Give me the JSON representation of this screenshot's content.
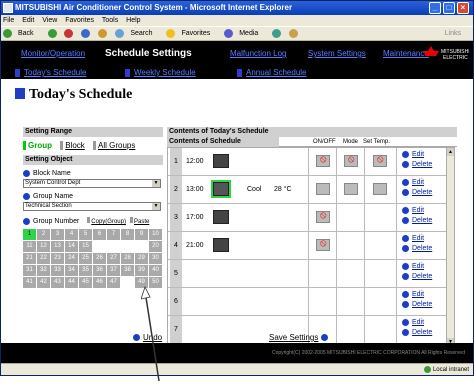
{
  "window": {
    "title": "MITSUBISHI Air Conditioner Control System - Microsoft Internet Explorer"
  },
  "menu": [
    "File",
    "Edit",
    "View",
    "Favorites",
    "Tools",
    "Help"
  ],
  "toolbar": {
    "back": "Back",
    "search": "Search",
    "favorites": "Favorites",
    "media": "Media",
    "links": "Links"
  },
  "nav": {
    "tabs": [
      "Monitor/Operation",
      "Schedule Settings",
      "Malfunction Log",
      "System Settings",
      "Maintenance"
    ],
    "sub": [
      "Today's Schedule",
      "Weekly Schedule",
      "Annual Schedule"
    ]
  },
  "page_title": "Today's Schedule",
  "left": {
    "setting_range": "Setting Range",
    "range_options": [
      "Group",
      "Block",
      "All Groups"
    ],
    "setting_object": "Setting Object",
    "block_name_label": "Block Name",
    "block_name_value": "System Control Dept",
    "group_name_label": "Group Name",
    "group_name_value": "Technical Section",
    "group_number_label": "Group Number",
    "copy_label": "Copy(Group)",
    "paste_label": "Paste",
    "numbers": [
      "1",
      "2",
      "3",
      "4",
      "5",
      "6",
      "7",
      "8",
      "9",
      "10",
      "11",
      "12",
      "13",
      "14",
      "15",
      "",
      "",
      "",
      "",
      "20",
      "21",
      "22",
      "23",
      "24",
      "25",
      "26",
      "27",
      "28",
      "29",
      "30",
      "31",
      "32",
      "33",
      "34",
      "35",
      "36",
      "37",
      "38",
      "39",
      "40",
      "41",
      "42",
      "43",
      "44",
      "45",
      "46",
      "47",
      "",
      "49",
      "50"
    ]
  },
  "right": {
    "title": "Contents of Today's Schedule",
    "subtitle": "Contents of Schedule",
    "cols": [
      "ON/OFF",
      "Mode",
      "Set Temp."
    ],
    "edit": "Edit",
    "delete": "Delete",
    "rows": [
      {
        "num": "1",
        "time": "12:00",
        "mode": "",
        "temp": ""
      },
      {
        "num": "2",
        "time": "13:00",
        "mode": "Cool",
        "temp": "28 °C"
      },
      {
        "num": "3",
        "time": "17:00",
        "mode": "",
        "temp": ""
      },
      {
        "num": "4",
        "time": "21:00",
        "mode": "",
        "temp": ""
      },
      {
        "num": "5",
        "time": "",
        "mode": "",
        "temp": ""
      },
      {
        "num": "6",
        "time": "",
        "mode": "",
        "temp": ""
      },
      {
        "num": "7",
        "time": "",
        "mode": "",
        "temp": ""
      }
    ]
  },
  "bottom": {
    "undo": "Undo",
    "save": "Save Settings"
  },
  "footer": "Copyright(C) 2002-2005 MITSUBISHI ELECTRIC CORPORATION All Rights Reserved",
  "status": {
    "zone": "Local intranet"
  }
}
